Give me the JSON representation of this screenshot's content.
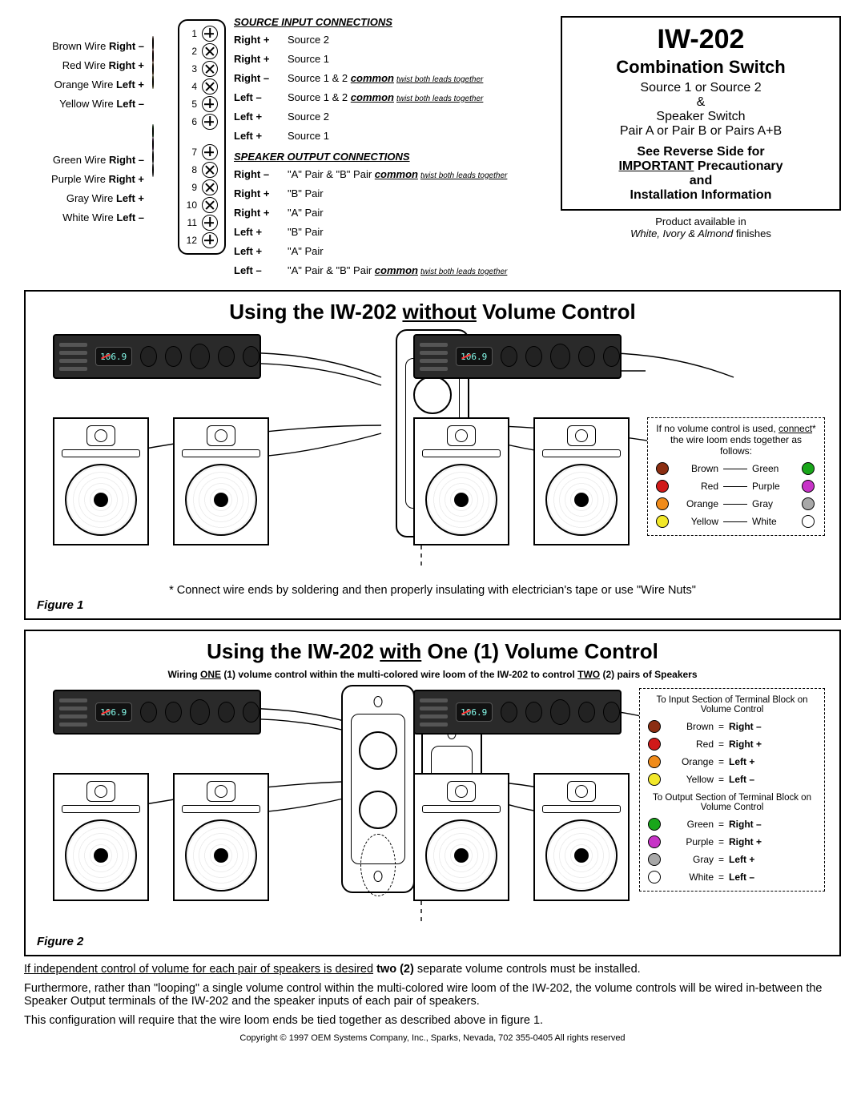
{
  "wires": {
    "a": [
      {
        "color": "#8b2e12",
        "name": "Brown Wire",
        "ch": "Right –"
      },
      {
        "color": "#d11919",
        "name": "Red Wire",
        "ch": "Right +"
      },
      {
        "color": "#f08b1a",
        "name": "Orange Wire",
        "ch": "Left +"
      },
      {
        "color": "#f2e82a",
        "name": "Yellow Wire",
        "ch": "Left –"
      }
    ],
    "b": [
      {
        "color": "#19a61a",
        "name": "Green Wire",
        "ch": "Right –"
      },
      {
        "color": "#c733c7",
        "name": "Purple Wire",
        "ch": "Right +"
      },
      {
        "color": "#a8a8a8",
        "name": "Gray Wire",
        "ch": "Left +"
      },
      {
        "color": "#ffffff",
        "name": "White Wire",
        "ch": "Left –"
      }
    ]
  },
  "terminals": {
    "source_head": "SOURCE INPUT  CONNECTIONS",
    "speaker_head": "SPEAKER OUTPUT  CONNECTIONS",
    "twist": "twist both leads together",
    "source": [
      {
        "n": "1",
        "t": "plus",
        "a": "Right +",
        "b": "Source 2"
      },
      {
        "n": "2",
        "t": "x",
        "a": "Right +",
        "b": "Source 1"
      },
      {
        "n": "3",
        "t": "x",
        "a": "Right –",
        "b": "Source 1 & 2 ",
        "c": true
      },
      {
        "n": "4",
        "t": "x",
        "a": "Left –",
        "b": "Source 1 & 2 ",
        "c": true
      },
      {
        "n": "5",
        "t": "plus",
        "a": "Left +",
        "b": "Source 2"
      },
      {
        "n": "6",
        "t": "plus",
        "a": "Left +",
        "b": "Source 1"
      }
    ],
    "speaker": [
      {
        "n": "7",
        "t": "plus",
        "a": "Right –",
        "b": "\"A\" Pair & \"B\" Pair ",
        "c": true
      },
      {
        "n": "8",
        "t": "x",
        "a": "Right +",
        "b": "\"B\" Pair"
      },
      {
        "n": "9",
        "t": "x",
        "a": "Right +",
        "b": "\"A\" Pair"
      },
      {
        "n": "10",
        "t": "x",
        "a": "Left +",
        "b": "\"B\" Pair"
      },
      {
        "n": "11",
        "t": "plus",
        "a": "Left +",
        "b": "\"A\" Pair"
      },
      {
        "n": "12",
        "t": "plus",
        "a": "Left  –",
        "b": "\"A\" Pair & \"B\" Pair ",
        "c": true
      }
    ]
  },
  "info": {
    "title": "IW-202",
    "sub": "Combination Switch",
    "l1": "Source 1 or Source 2",
    "amp": "&",
    "l2": "Speaker Switch",
    "l3": "Pair A or Pair B or Pairs A+B",
    "rev1": "See Reverse Side for",
    "rev2u": "IMPORTANT",
    "rev2": " Precautionary",
    "rev3": "and",
    "rev4": "Installation Information",
    "avail1": "Product available in",
    "avail2": "White, Ivory & Almond",
    "avail3": " finishes"
  },
  "panel1": {
    "title_a": "Using the IW-202 ",
    "title_u": "without",
    "title_b": " Volume Control",
    "note": "* Connect wire ends by soldering and then properly insulating with electrician's tape or use \"Wire Nuts\"",
    "fig": "Figure 1",
    "display": "106.9",
    "legend_head": "If no volume control is used, ",
    "legend_head_u": "connect",
    "legend_head_b": "* the wire loom ends together as follows:",
    "pairs": [
      {
        "ca": "#8b2e12",
        "a": "Brown",
        "cb": "#19a61a",
        "b": "Green"
      },
      {
        "ca": "#d11919",
        "a": "Red",
        "cb": "#c733c7",
        "b": "Purple"
      },
      {
        "ca": "#f08b1a",
        "a": "Orange",
        "cb": "#a8a8a8",
        "b": "Gray"
      },
      {
        "ca": "#f2e82a",
        "a": "Yellow",
        "cb": "#ffffff",
        "b": "White"
      }
    ]
  },
  "panel2": {
    "title_a": "Using the IW-202 ",
    "title_u": "with",
    "title_b": " One (1) Volume Control",
    "sub_a": "Wiring ",
    "sub_u1": "ONE",
    "sub_b": " (1) volume control within the multi-colored wire loom of the IW-202 to control ",
    "sub_u2": "TWO",
    "sub_c": " (2) pairs of Speakers",
    "fig": "Figure 2",
    "display": "106.9",
    "leg_sec1": "To Input Section of Terminal Block on Volume Control",
    "leg_sec2": "To Output Section of Terminal Block on Volume Control",
    "in": [
      {
        "c": "#8b2e12",
        "a": "Brown",
        "b": "Right –"
      },
      {
        "c": "#d11919",
        "a": "Red",
        "b": "Right +"
      },
      {
        "c": "#f08b1a",
        "a": "Orange",
        "b": "Left +"
      },
      {
        "c": "#f2e82a",
        "a": "Yellow",
        "b": "Left –"
      }
    ],
    "out": [
      {
        "c": "#19a61a",
        "a": "Green",
        "b": "Right –"
      },
      {
        "c": "#c733c7",
        "a": "Purple",
        "b": "Right +"
      },
      {
        "c": "#a8a8a8",
        "a": "Gray",
        "b": "Left +"
      },
      {
        "c": "#ffffff",
        "a": "White",
        "b": "Left –"
      }
    ]
  },
  "paras": {
    "p1a": "If independent control of volume for each pair of speakers is desired",
    "p1b": " two (2) ",
    "p1c": "separate volume controls must  be installed.",
    "p2": "Furthermore, rather than \"looping\" a single volume control within the multi-colored wire loom of the IW-202, the volume controls will be wired in-between the Speaker Output terminals of the IW-202 and the speaker inputs of each pair of speakers.",
    "p3": "This configuration will require that the wire loom ends be tied together as described above in figure 1."
  },
  "copyright": "Copyright © 1997 OEM Systems Company, Inc., Sparks, Nevada, 702 355-0405   All rights reserved"
}
